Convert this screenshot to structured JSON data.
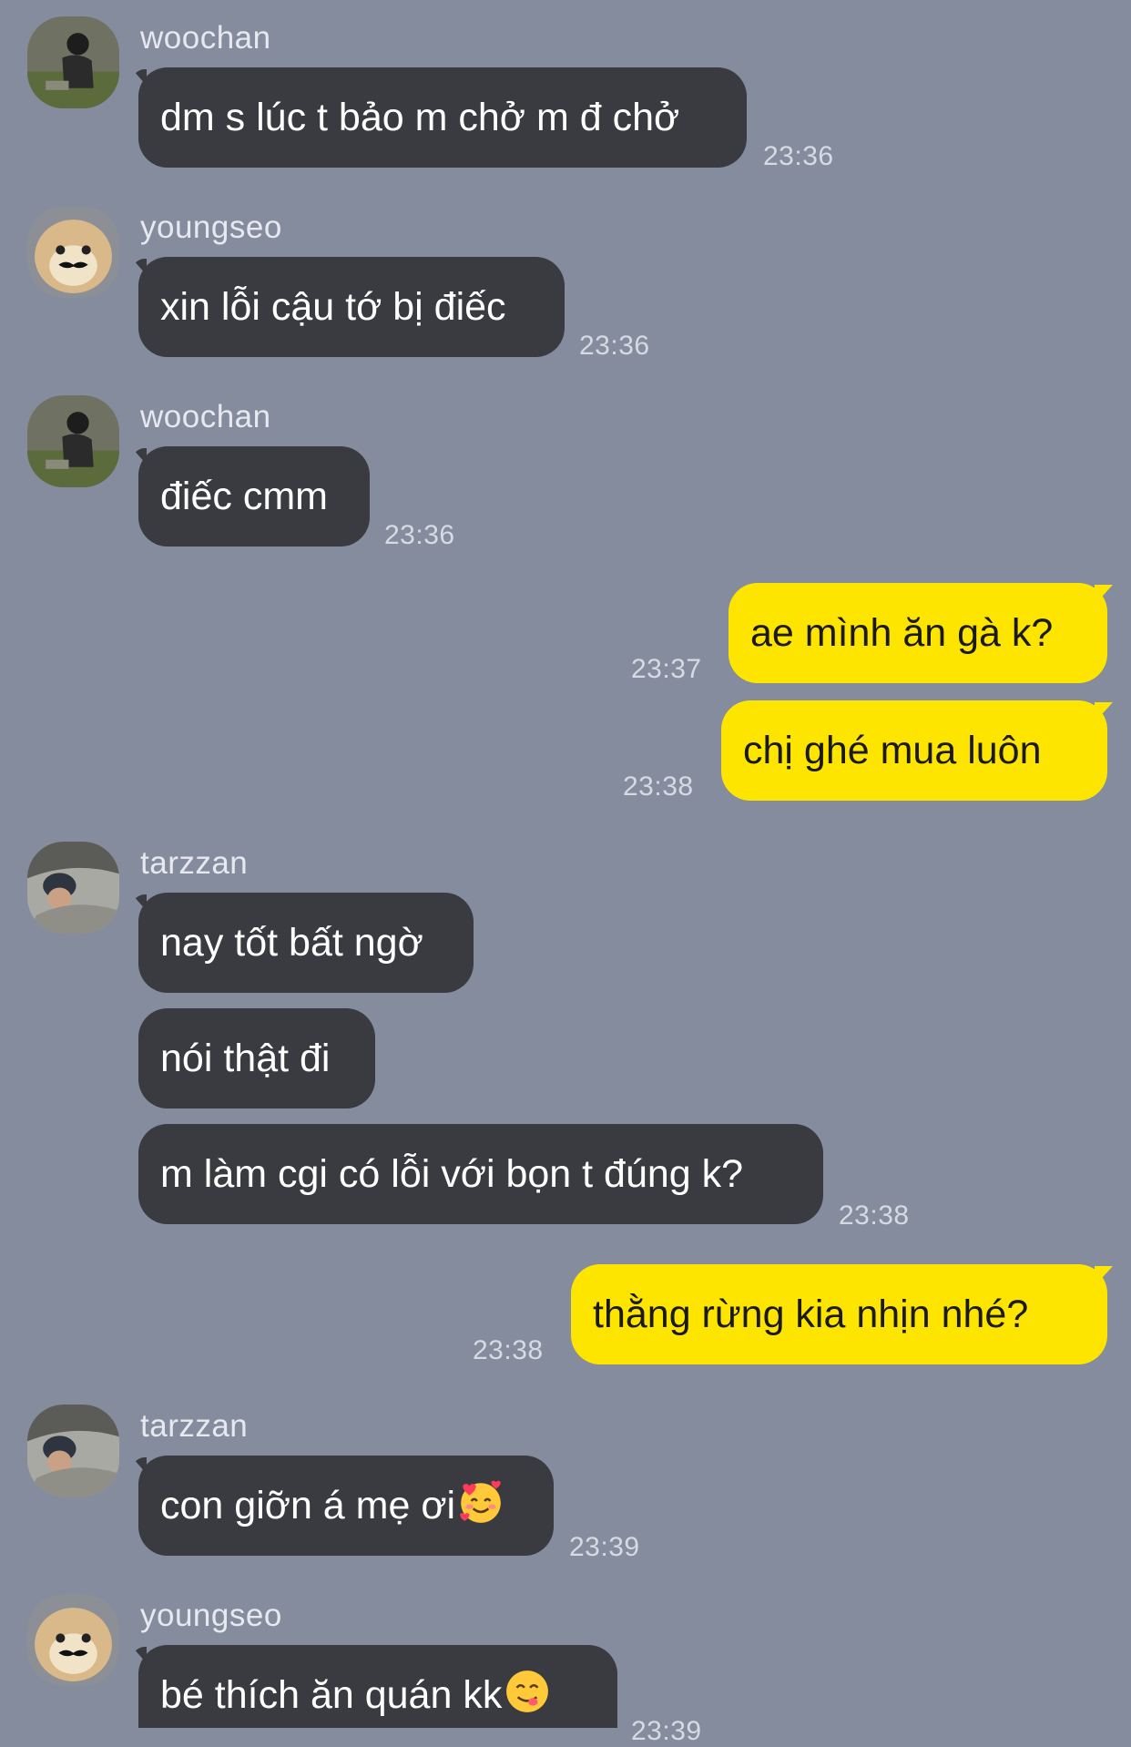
{
  "messages": [
    {
      "sender": "woochan",
      "text": "dm s lúc t bảo m chở m đ chở",
      "time": "23:36"
    },
    {
      "sender": "youngseo",
      "text": "xin lỗi cậu tớ bị điếc",
      "time": "23:36"
    },
    {
      "sender": "woochan",
      "text": "điếc cmm",
      "time": "23:36"
    },
    {
      "text": "ae mình ăn gà k?",
      "time": "23:37"
    },
    {
      "text": "chị ghé mua luôn",
      "time": "23:38"
    },
    {
      "sender": "tarzzan",
      "text": "nay tốt bất ngờ"
    },
    {
      "text": "nói thật đi"
    },
    {
      "text": "m làm cgi có lỗi với bọn t đúng k?",
      "time": "23:38"
    },
    {
      "text": "thằng rừng kia nhịn nhé?",
      "time": "23:38"
    },
    {
      "sender": "tarzzan",
      "text": "con giỡn á mẹ ơi",
      "emoji": "smiling-face-with-hearts",
      "time": "23:39"
    },
    {
      "sender": "youngseo",
      "text": "bé thích ăn quán kk",
      "emoji": "face-savoring-food",
      "time": "23:39"
    }
  ],
  "colors": {
    "background": "#848c9e",
    "incoming_bubble": "#3a3b40",
    "outgoing_bubble": "#fee500",
    "incoming_text": "#ffffff",
    "outgoing_text": "#1a1a1a",
    "timestamp": "#d6dae2",
    "sender_name": "#e6e9ef"
  }
}
